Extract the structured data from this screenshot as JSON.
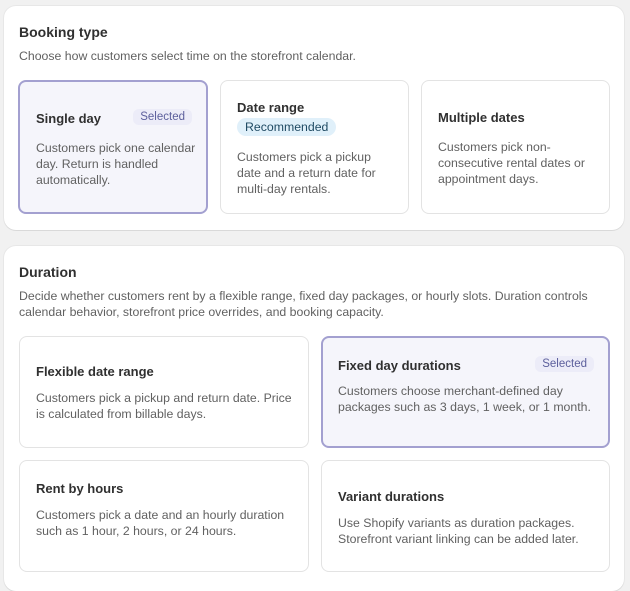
{
  "booking_type": {
    "title": "Booking type",
    "description": "Choose how customers select time on the storefront calendar.",
    "options": [
      {
        "title": "Single day",
        "badge": "Selected",
        "description": "Customers pick one calendar day. Return is handled automatically.",
        "selected": true
      },
      {
        "title": "Date range",
        "badge": "Recommended",
        "description": "Customers pick a pickup date and a return date for multi-day rentals.",
        "selected": false
      },
      {
        "title": "Multiple dates",
        "description": "Customers pick non-consecutive rental dates or appointment days.",
        "selected": false
      }
    ]
  },
  "duration": {
    "title": "Duration",
    "description": "Decide whether customers rent by a flexible range, fixed day packages, or hourly slots. Duration controls calendar behavior, storefront price overrides, and booking capacity.",
    "options": [
      {
        "title": "Flexible date range",
        "description": "Customers pick a pickup and return date. Price is calculated from billable days.",
        "selected": false
      },
      {
        "title": "Fixed day durations",
        "badge": "Selected",
        "description": "Customers choose merchant-defined day packages such as 3 days, 1 week, or 1 month.",
        "selected": true
      },
      {
        "title": "Rent by hours",
        "description": "Customers pick a date and an hourly duration such as 1 hour, 2 hours, or 24 hours.",
        "selected": false
      },
      {
        "title": "Variant durations",
        "description": "Use Shopify variants as duration packages. Storefront variant linking can be added later.",
        "selected": false
      }
    ]
  },
  "colors": {
    "selected_border": "#a3a0d0",
    "selected_background": "#f5f5fb",
    "selected_badge_text": "#5c5f9c",
    "recommended_badge_background": "#e0f0fa"
  }
}
